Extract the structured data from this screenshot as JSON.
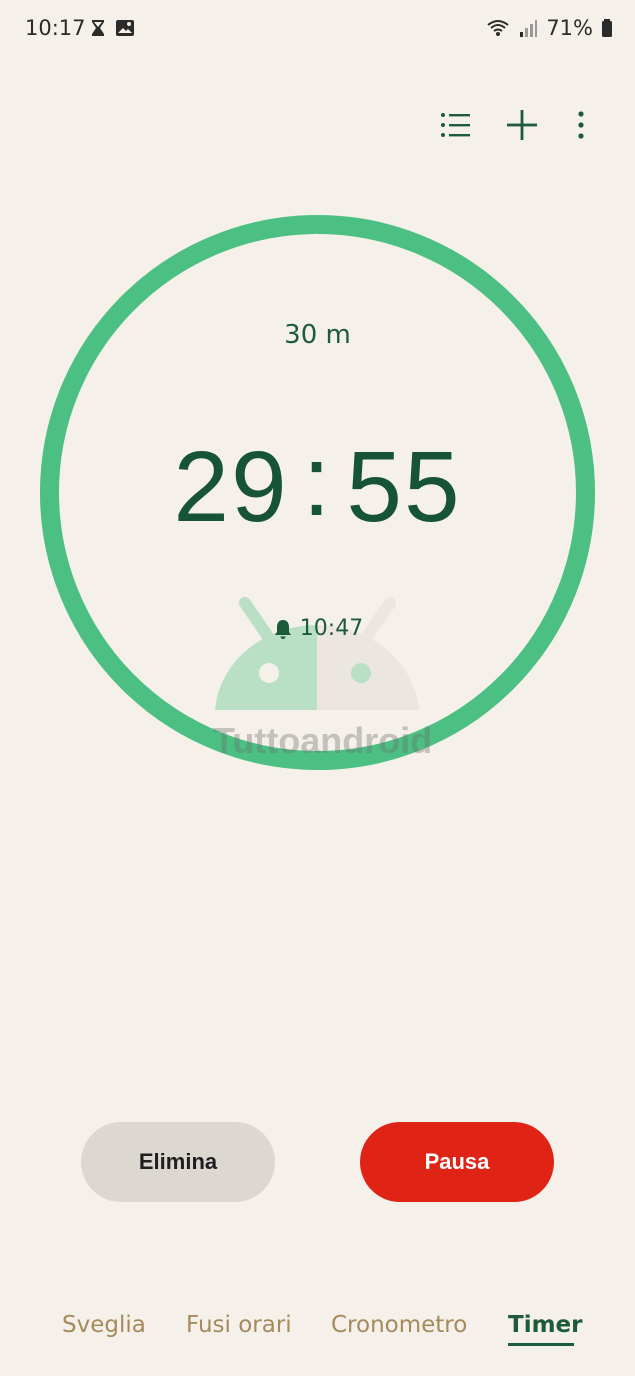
{
  "status_bar": {
    "time": "10:17",
    "battery": "71%",
    "icons": [
      "hourglass-icon",
      "image-icon",
      "wifi-icon",
      "signal-icon",
      "battery-icon"
    ]
  },
  "toolbar": {
    "icons": [
      "list-icon",
      "plus-icon",
      "more-vert-icon"
    ]
  },
  "timer": {
    "duration": "30 m",
    "minutes": "29",
    "separator": ":",
    "seconds": "55",
    "end_time": "10:47",
    "progress": 0.997
  },
  "actions": {
    "delete_label": "Elimina",
    "pause_label": "Pausa"
  },
  "nav": {
    "tabs": [
      {
        "label": "Sveglia",
        "active": false
      },
      {
        "label": "Fusi orari",
        "active": false
      },
      {
        "label": "Cronometro",
        "active": false
      },
      {
        "label": "Timer",
        "active": true
      }
    ]
  },
  "watermark": {
    "text": "Tuttoandroid"
  },
  "colors": {
    "background": "#f5f1ea",
    "ring": "#4cc083",
    "primary_text": "#1e5a3c",
    "pause": "#df2416",
    "delete": "#dcd8d1",
    "nav_inactive": "#a58a5c"
  }
}
